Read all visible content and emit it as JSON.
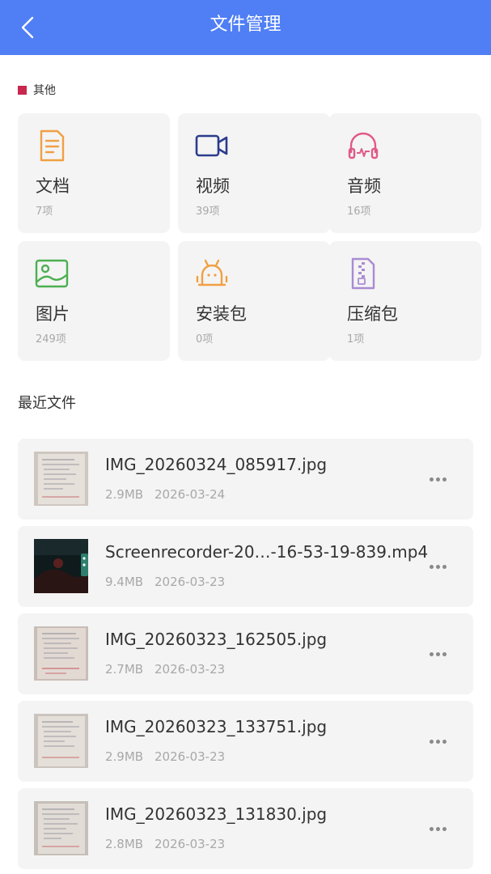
{
  "header": {
    "title": "文件管理"
  },
  "category_section": {
    "label": "其他",
    "marker_color": "#c8284e"
  },
  "categories": [
    {
      "label": "文档",
      "count": "7项",
      "icon": "document-icon",
      "color": "#f0a043"
    },
    {
      "label": "视频",
      "count": "39项",
      "icon": "video-camera-icon",
      "color": "#2b3c8c"
    },
    {
      "label": "音频",
      "count": "16项",
      "icon": "headphones-icon",
      "color": "#e05a86"
    },
    {
      "label": "图片",
      "count": "249项",
      "icon": "image-icon",
      "color": "#4caf50"
    },
    {
      "label": "安装包",
      "count": "0项",
      "icon": "android-icon",
      "color": "#f0a043"
    },
    {
      "label": "压缩包",
      "count": "1项",
      "icon": "zip-icon",
      "color": "#a98bd3"
    }
  ],
  "recent": {
    "title": "最近文件",
    "files": [
      {
        "name": "IMG_20260324_085917.jpg",
        "size": "2.9MB",
        "date": "2026-03-24",
        "thumb": "document-photo"
      },
      {
        "name": "Screenrecorder-20…-16-53-19-839.mp4",
        "size": "9.4MB",
        "date": "2026-03-23",
        "thumb": "video-frame"
      },
      {
        "name": "IMG_20260323_162505.jpg",
        "size": "2.7MB",
        "date": "2026-03-23",
        "thumb": "document-photo"
      },
      {
        "name": "IMG_20260323_133751.jpg",
        "size": "2.9MB",
        "date": "2026-03-23",
        "thumb": "document-photo"
      },
      {
        "name": "IMG_20260323_131830.jpg",
        "size": "2.8MB",
        "date": "2026-03-23",
        "thumb": "document-photo"
      }
    ]
  },
  "colors": {
    "header_bg": "#4f7ef5",
    "tile_bg": "#f4f4f4",
    "muted_text": "#a8a8a8"
  }
}
